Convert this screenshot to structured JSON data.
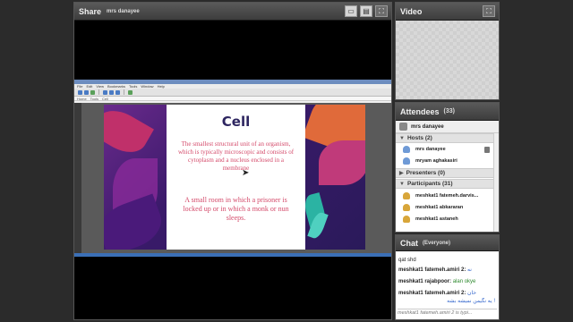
{
  "share": {
    "title": "Share",
    "presenter": "mrs danayee",
    "icons": [
      "layout-icon",
      "view-icon",
      "fullscreen-icon"
    ]
  },
  "screen": {
    "menu": [
      "File",
      "Edit",
      "View",
      "Bookmarks",
      "Tools",
      "Window",
      "Help"
    ],
    "addr": [
      "Home",
      "Tools",
      "Cell"
    ]
  },
  "slide": {
    "title": "Cell",
    "body1": "The smallest structural unit of an organism, which is typically microscopic and consists of cytoplasm and a nucleus enclosed in a membrane",
    "body2": "A small room in which a prisoner is locked up or in which a monk or nun sleeps."
  },
  "video": {
    "title": "Video"
  },
  "attendees": {
    "title": "Attendees",
    "count": "(33)",
    "current_user": "mrs danayee",
    "hosts_label": "Hosts (2)",
    "hosts": [
      "mrs danayee",
      "mryam aghakasiri"
    ],
    "presenters_label": "Presenters (0)",
    "participants_label": "Participants (31)",
    "participants": [
      "meshkat1 fatemeh.darvis...",
      "meshkat1 abkararan",
      "meshkat1 astaneh"
    ]
  },
  "chat": {
    "title": "Chat",
    "scope": "(Everyone)",
    "messages": [
      {
        "name": "",
        "text": "qat shd",
        "style": "plain"
      },
      {
        "name": "meshkat1 fatemeh.amiri 2:",
        "text": "نه",
        "style": "blue"
      },
      {
        "name": "meshkat1 rajabpoor:",
        "text": "alan okye",
        "style": "green"
      },
      {
        "name": "meshkat1 fatemeh.amiri 2:",
        "text": "خان",
        "style": "blue"
      },
      {
        "name": "",
        "text": "یه نگیمن نمیشه بشه !",
        "style": "blue"
      }
    ],
    "typing": "meshkat1 fatemeh.amiri 2 is typi..."
  },
  "colors": {
    "accent_blue": "#3366cc",
    "accent_green": "#2f8a2f",
    "slide_text": "#d44a6a",
    "slide_title": "#2d2560"
  }
}
